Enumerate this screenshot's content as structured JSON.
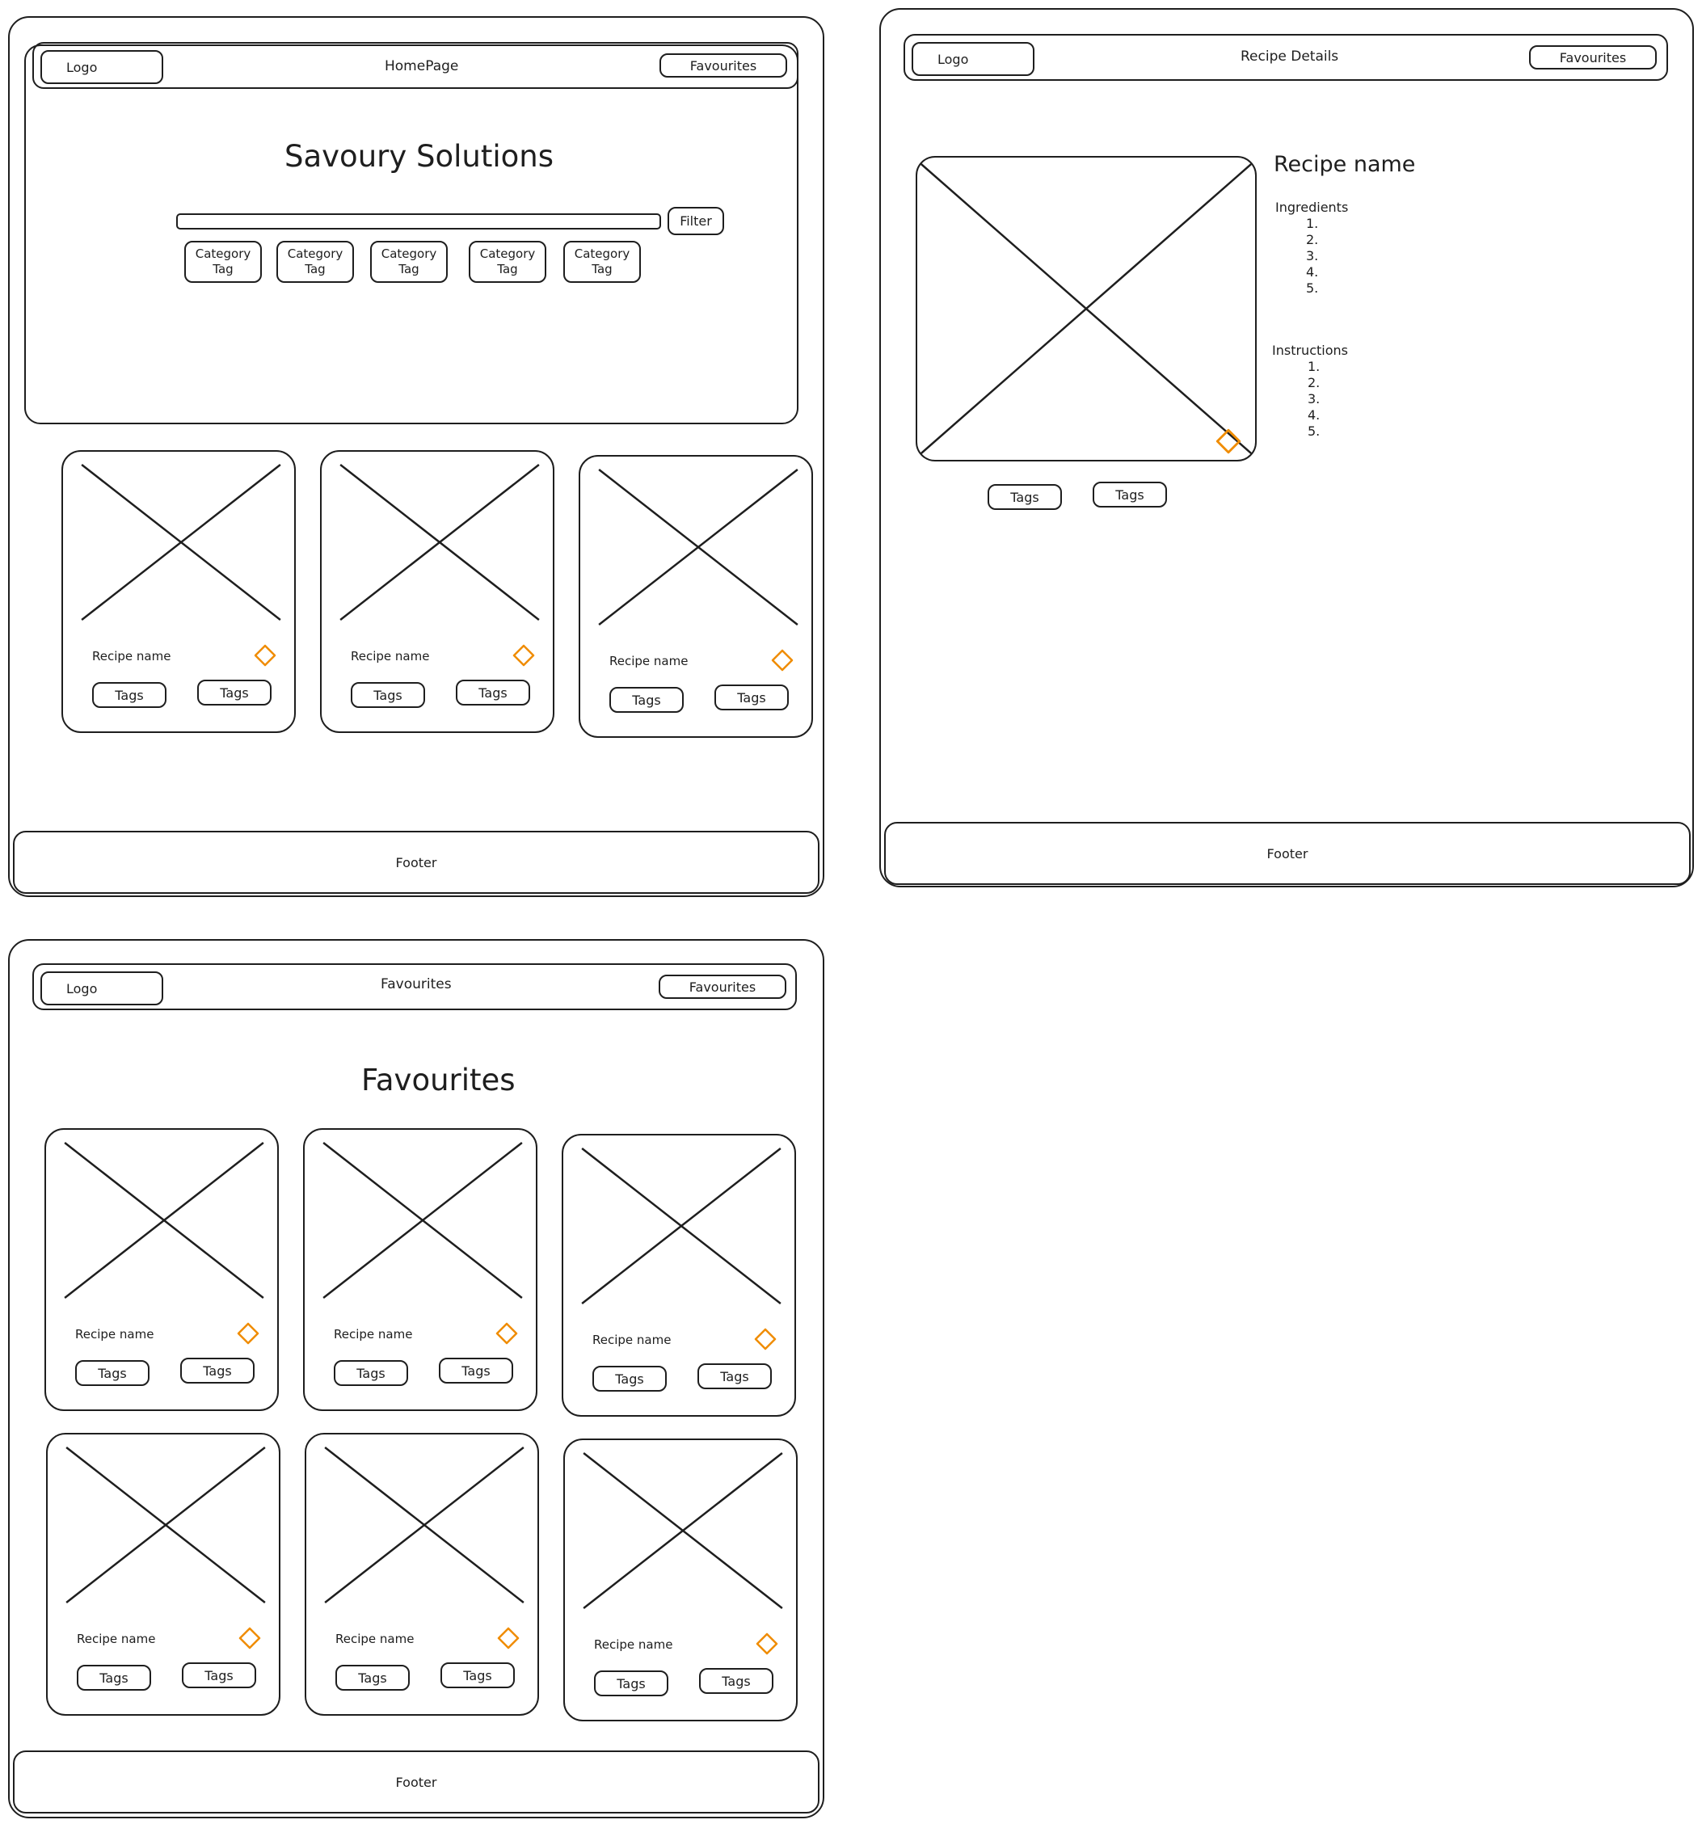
{
  "colors": {
    "stroke": "#1e1e1e",
    "favourite": "#f08c00"
  },
  "homepage": {
    "nav": {
      "logo": "Logo",
      "title": "HomePage",
      "favourites": "Favourites"
    },
    "hero_title": "Savoury Solutions",
    "filter_label": "Filter",
    "category_tags": [
      "Category\nTag",
      "Category\nTag",
      "Category\nTag",
      "Category\nTag",
      "Category\nTag"
    ],
    "cards": [
      {
        "name": "Recipe name",
        "tags": [
          "Tags",
          "Tags"
        ]
      },
      {
        "name": "Recipe name",
        "tags": [
          "Tags",
          "Tags"
        ]
      },
      {
        "name": "Recipe name",
        "tags": [
          "Tags",
          "Tags"
        ]
      }
    ],
    "footer": "Footer"
  },
  "details": {
    "nav": {
      "logo": "Logo",
      "title": "Recipe Details",
      "favourites": "Favourites"
    },
    "recipe_name": "Recipe name",
    "ingredients_label": "Ingredients",
    "ingredients": [
      "1.",
      "2.",
      "3.",
      "4.",
      "5."
    ],
    "instructions_label": "Instructions",
    "instructions": [
      "1.",
      "2.",
      "3.",
      "4.",
      "5."
    ],
    "tags": [
      "Tags",
      "Tags"
    ],
    "footer": "Footer"
  },
  "favourites": {
    "nav": {
      "logo": "Logo",
      "title": "Favourites",
      "favourites": "Favourites"
    },
    "heading": "Favourites",
    "cards": [
      {
        "name": "Recipe name",
        "tags": [
          "Tags",
          "Tags"
        ]
      },
      {
        "name": "Recipe name",
        "tags": [
          "Tags",
          "Tags"
        ]
      },
      {
        "name": "Recipe name",
        "tags": [
          "Tags",
          "Tags"
        ]
      },
      {
        "name": "Recipe name",
        "tags": [
          "Tags",
          "Tags"
        ]
      },
      {
        "name": "Recipe name",
        "tags": [
          "Tags",
          "Tags"
        ]
      },
      {
        "name": "Recipe name",
        "tags": [
          "Tags",
          "Tags"
        ]
      }
    ],
    "footer": "Footer"
  }
}
